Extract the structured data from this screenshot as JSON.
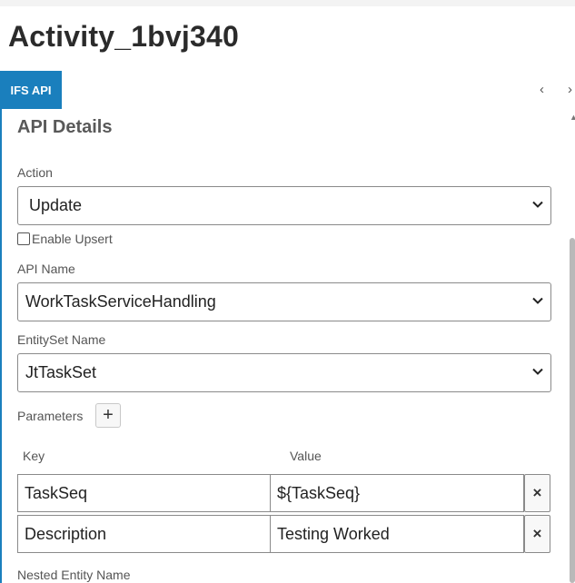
{
  "page": {
    "title": "Activity_1bvj340"
  },
  "tab": {
    "label": "IFS API"
  },
  "nav": {
    "prev_glyph": "‹",
    "next_glyph": "›"
  },
  "panel": {
    "section_title": "API Details",
    "action": {
      "label": "Action",
      "value": "Update"
    },
    "enable_upsert": {
      "label": "Enable Upsert",
      "checked": false
    },
    "api_name": {
      "label": "API Name",
      "value": "WorkTaskServiceHandling"
    },
    "entityset": {
      "label": "EntitySet Name",
      "value": "JtTaskSet"
    },
    "parameters": {
      "label": "Parameters",
      "add_glyph": "+",
      "key_header": "Key",
      "value_header": "Value",
      "rows": [
        {
          "key": "TaskSeq",
          "value": "${TaskSeq}",
          "delete_glyph": "×"
        },
        {
          "key": "Description",
          "value": "Testing Worked",
          "delete_glyph": "×"
        }
      ]
    },
    "nested_entity": {
      "label": "Nested Entity Name"
    }
  },
  "colors": {
    "accent": "#1a7fbd"
  }
}
